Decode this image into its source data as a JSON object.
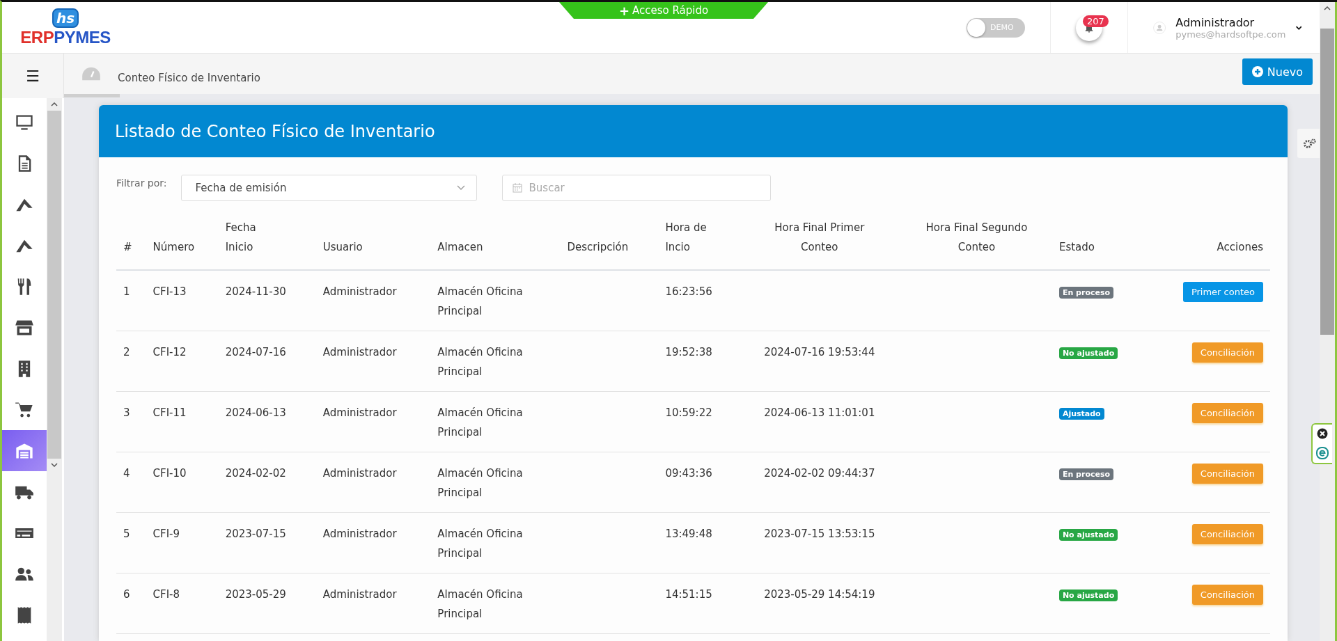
{
  "header": {
    "logo_top": "hs",
    "logo_left": "ERP",
    "logo_right": "PYMES",
    "quick_access": {
      "icon": "+",
      "label": "Acceso Rápido"
    },
    "demo_toggle": {
      "label": "DEMO",
      "on": false
    },
    "notifications": {
      "count": "207"
    },
    "user": {
      "name": "Administrador",
      "email": "pymes@hardsoftpe.com"
    }
  },
  "breadcrumb": {
    "menu_icon": "☰",
    "title": "Conteo Físico de Inventario"
  },
  "new_button": {
    "label": "Nuevo"
  },
  "sidebar": {
    "items": [
      {
        "selected": false
      },
      {
        "selected": false
      },
      {
        "selected": false
      },
      {
        "selected": false
      },
      {
        "selected": false
      },
      {
        "selected": false
      },
      {
        "selected": false
      },
      {
        "selected": false
      },
      {
        "selected": true
      },
      {
        "selected": false
      },
      {
        "selected": false
      },
      {
        "selected": false
      },
      {
        "selected": false
      }
    ]
  },
  "card": {
    "title": "Listado de Conteo Físico de Inventario",
    "filter": {
      "label": "Filtrar por:",
      "value": "Fecha de emisión",
      "search_placeholder": "Buscar"
    },
    "table": {
      "columns": [
        [
          "#"
        ],
        [
          "Número"
        ],
        [
          "Fecha",
          "Inicio"
        ],
        [
          "Usuario"
        ],
        [
          "Almacen"
        ],
        [
          "Descripción"
        ],
        [
          "Hora de",
          "Incio"
        ],
        [
          "Hora Final Primer",
          "Conteo"
        ],
        [
          "Hora Final Segundo",
          "Conteo"
        ],
        [
          "Estado"
        ],
        [
          "Acciones"
        ]
      ],
      "rows": [
        {
          "n": "1",
          "numero": "CFI-13",
          "fecha": "2024-11-30",
          "usuario": "Administrador",
          "almacen": [
            "Almacén Oficina",
            "Principal"
          ],
          "hora_inicio": "16:23:56",
          "hora_primer": "",
          "status": {
            "label": "En proceso",
            "color": "#6c757d"
          },
          "action": {
            "label": "Primer conteo",
            "kind": "primary"
          }
        },
        {
          "n": "2",
          "numero": "CFI-12",
          "fecha": "2024-07-16",
          "usuario": "Administrador",
          "almacen": [
            "Almacén Oficina",
            "Principal"
          ],
          "hora_inicio": "19:52:38",
          "hora_primer": "2024-07-16 19:53:44",
          "status": {
            "label": "No ajustado",
            "color": "#28a745"
          },
          "action": {
            "label": "Conciliación",
            "kind": "warning"
          }
        },
        {
          "n": "3",
          "numero": "CFI-11",
          "fecha": "2024-06-13",
          "usuario": "Administrador",
          "almacen": [
            "Almacén Oficina",
            "Principal"
          ],
          "hora_inicio": "10:59:22",
          "hora_primer": "2024-06-13 11:01:01",
          "status": {
            "label": "Ajustado",
            "color": "#0288d1"
          },
          "action": {
            "label": "Conciliación",
            "kind": "warning"
          }
        },
        {
          "n": "4",
          "numero": "CFI-10",
          "fecha": "2024-02-02",
          "usuario": "Administrador",
          "almacen": [
            "Almacén Oficina",
            "Principal"
          ],
          "hora_inicio": "09:43:36",
          "hora_primer": "2024-02-02 09:44:37",
          "status": {
            "label": "En proceso",
            "color": "#6c757d"
          },
          "action": {
            "label": "Conciliación",
            "kind": "warning"
          }
        },
        {
          "n": "5",
          "numero": "CFI-9",
          "fecha": "2023-07-15",
          "usuario": "Administrador",
          "almacen": [
            "Almacén Oficina",
            "Principal"
          ],
          "hora_inicio": "13:49:48",
          "hora_primer": "2023-07-15 13:53:15",
          "status": {
            "label": "No ajustado",
            "color": "#28a745"
          },
          "action": {
            "label": "Conciliación",
            "kind": "warning"
          }
        },
        {
          "n": "6",
          "numero": "CFI-8",
          "fecha": "2023-05-29",
          "usuario": "Administrador",
          "almacen": [
            "Almacén Oficina",
            "Principal"
          ],
          "hora_inicio": "14:51:15",
          "hora_primer": "2023-05-29 14:54:19",
          "status": {
            "label": "No ajustado",
            "color": "#28a745"
          },
          "action": {
            "label": "Conciliación",
            "kind": "warning"
          }
        }
      ]
    }
  }
}
